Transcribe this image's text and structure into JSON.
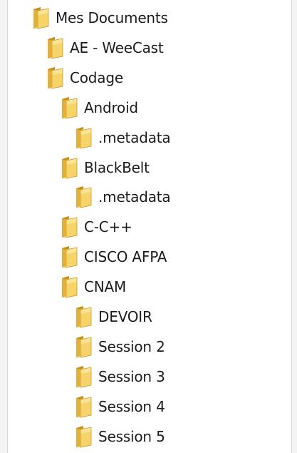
{
  "tree": {
    "items": [
      {
        "label": "Mes Documents",
        "level": 0,
        "icon": "folder-icon"
      },
      {
        "label": "AE - WeeCast",
        "level": 1,
        "icon": "folder-icon"
      },
      {
        "label": "Codage",
        "level": 1,
        "icon": "folder-icon"
      },
      {
        "label": "Android",
        "level": 2,
        "icon": "folder-icon"
      },
      {
        "label": ".metadata",
        "level": 3,
        "icon": "folder-icon"
      },
      {
        "label": "BlackBelt",
        "level": 2,
        "icon": "folder-icon"
      },
      {
        "label": ".metadata",
        "level": 3,
        "icon": "folder-icon"
      },
      {
        "label": "C-C++",
        "level": 2,
        "icon": "folder-icon"
      },
      {
        "label": "CISCO AFPA",
        "level": 2,
        "icon": "folder-icon"
      },
      {
        "label": "CNAM",
        "level": 2,
        "icon": "folder-icon"
      },
      {
        "label": "DEVOIR",
        "level": 3,
        "icon": "folder-icon"
      },
      {
        "label": "Session 2",
        "level": 3,
        "icon": "folder-icon"
      },
      {
        "label": "Session 3",
        "level": 3,
        "icon": "folder-icon"
      },
      {
        "label": "Session 4",
        "level": 3,
        "icon": "folder-icon"
      },
      {
        "label": "Session 5",
        "level": 3,
        "icon": "folder-icon"
      }
    ]
  },
  "colors": {
    "folder_back": "#d9a52b",
    "folder_front": "#f6d46a",
    "folder_front_light": "#fbe7a0",
    "text": "#1c1c1c"
  }
}
